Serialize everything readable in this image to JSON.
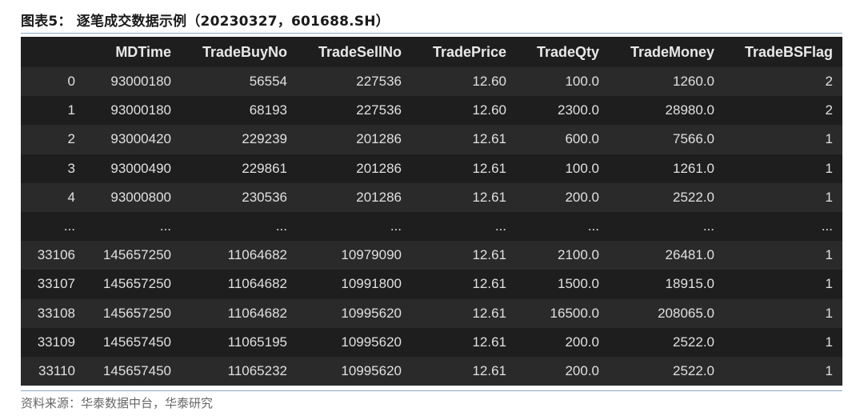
{
  "title": "图表5： 逐笔成交数据示例（20230327，601688.SH）",
  "table": {
    "columns": [
      "",
      "MDTime",
      "TradeBuyNo",
      "TradeSellNo",
      "TradePrice",
      "TradeQty",
      "TradeMoney",
      "TradeBSFlag"
    ],
    "rows": [
      [
        "0",
        "93000180",
        "56554",
        "227536",
        "12.60",
        "100.0",
        "1260.0",
        "2"
      ],
      [
        "1",
        "93000180",
        "68193",
        "227536",
        "12.60",
        "2300.0",
        "28980.0",
        "2"
      ],
      [
        "2",
        "93000420",
        "229239",
        "201286",
        "12.61",
        "600.0",
        "7566.0",
        "1"
      ],
      [
        "3",
        "93000490",
        "229861",
        "201286",
        "12.61",
        "100.0",
        "1261.0",
        "1"
      ],
      [
        "4",
        "93000800",
        "230536",
        "201286",
        "12.61",
        "200.0",
        "2522.0",
        "1"
      ],
      [
        "...",
        "...",
        "...",
        "...",
        "...",
        "...",
        "...",
        "..."
      ],
      [
        "33106",
        "145657250",
        "11064682",
        "10979090",
        "12.61",
        "2100.0",
        "26481.0",
        "1"
      ],
      [
        "33107",
        "145657250",
        "11064682",
        "10991800",
        "12.61",
        "1500.0",
        "18915.0",
        "1"
      ],
      [
        "33108",
        "145657250",
        "11064682",
        "10995620",
        "12.61",
        "16500.0",
        "208065.0",
        "1"
      ],
      [
        "33109",
        "145657450",
        "11065195",
        "10995620",
        "12.61",
        "200.0",
        "2522.0",
        "1"
      ],
      [
        "33110",
        "145657450",
        "11065232",
        "10995620",
        "12.61",
        "200.0",
        "2522.0",
        "1"
      ]
    ]
  },
  "source": "资料来源：华泰数据中台，华泰研究"
}
